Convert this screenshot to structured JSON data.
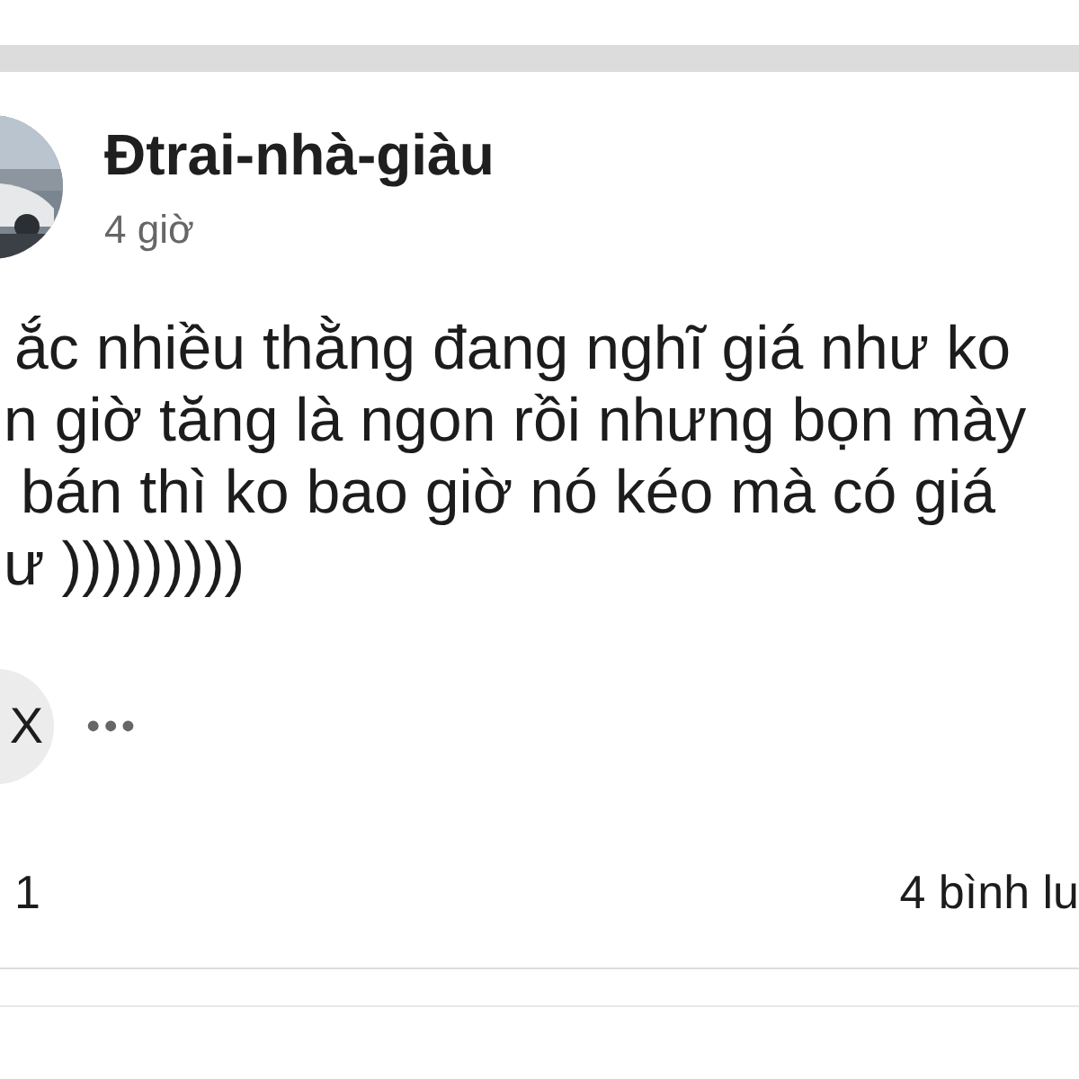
{
  "post": {
    "author": "Đtrai-nhà-giàu",
    "time": "4 giờ",
    "body_lines": [
      "ắc nhiều thằng đang nghĩ giá như ko",
      "n giờ tăng là ngon rồi nhưng bọn mày",
      " bán thì ko bao giờ nó kéo mà có giá",
      "ư )))))))))"
    ],
    "reaction": {
      "label": "X"
    },
    "more": "•••",
    "reaction_count": "1",
    "comment_count": "4 bình lu"
  }
}
